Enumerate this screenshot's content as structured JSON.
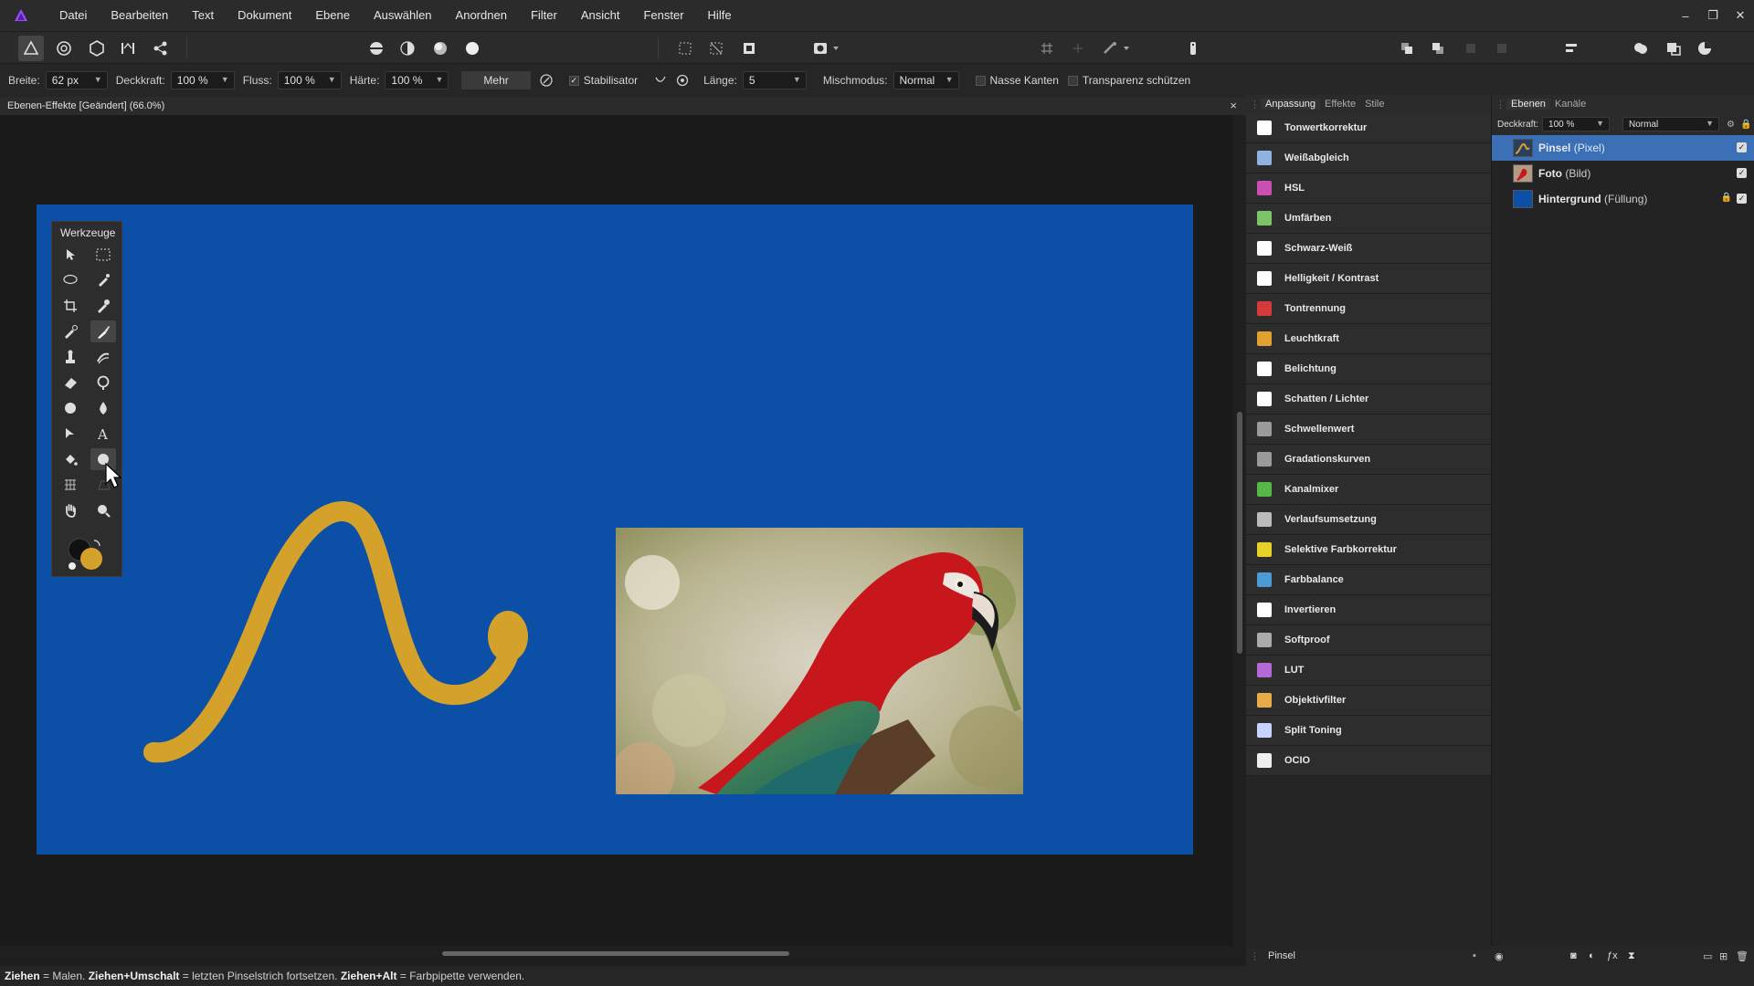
{
  "menu": [
    "Datei",
    "Bearbeiten",
    "Text",
    "Dokument",
    "Ebene",
    "Auswählen",
    "Anordnen",
    "Filter",
    "Ansicht",
    "Fenster",
    "Hilfe"
  ],
  "window_controls": {
    "minimize": "–",
    "restore": "❐",
    "close": "✕"
  },
  "context": {
    "width_label": "Breite:",
    "width_value": "62 px",
    "opacity_label": "Deckkraft:",
    "opacity_value": "100 %",
    "flow_label": "Fluss:",
    "flow_value": "100 %",
    "hardness_label": "Härte:",
    "hardness_value": "100 %",
    "more_label": "Mehr",
    "stabilizer_label": "Stabilisator",
    "length_label": "Länge:",
    "length_value": "5",
    "blend_label": "Mischmodus:",
    "blend_value": "Normal",
    "wet_edges_label": "Nasse Kanten",
    "protect_alpha_label": "Transparenz schützen"
  },
  "document": {
    "tab_title": "Ebenen-Effekte [Geändert] (66.0%)",
    "close": "×"
  },
  "tools": {
    "title": "Werkzeuge"
  },
  "adjustments": {
    "tabs": [
      "Anpassung",
      "Effekte",
      "Stile"
    ],
    "items": [
      {
        "label": "Tonwertkorrektur",
        "color": "#ffffff"
      },
      {
        "label": "Weißabgleich",
        "color": "#8fb4e0"
      },
      {
        "label": "HSL",
        "color": "#c94fb0"
      },
      {
        "label": "Umfärben",
        "color": "#7bc46a"
      },
      {
        "label": "Schwarz-Weiß",
        "color": "#ffffff"
      },
      {
        "label": "Helligkeit / Kontrast",
        "color": "#ffffff"
      },
      {
        "label": "Tontrennung",
        "color": "#d43a3a"
      },
      {
        "label": "Leuchtkraft",
        "color": "#e0a030"
      },
      {
        "label": "Belichtung",
        "color": "#ffffff"
      },
      {
        "label": "Schatten / Lichter",
        "color": "#ffffff"
      },
      {
        "label": "Schwellenwert",
        "color": "#9a9a9a"
      },
      {
        "label": "Gradationskurven",
        "color": "#9a9a9a"
      },
      {
        "label": "Kanalmixer",
        "color": "#56b847"
      },
      {
        "label": "Verlaufsumsetzung",
        "color": "#bbbbbb"
      },
      {
        "label": "Selektive Farbkorrektur",
        "color": "#e8d22a"
      },
      {
        "label": "Farbbalance",
        "color": "#4a9ad4"
      },
      {
        "label": "Invertieren",
        "color": "#ffffff"
      },
      {
        "label": "Softproof",
        "color": "#aaaaaa"
      },
      {
        "label": "LUT",
        "color": "#b36ad6"
      },
      {
        "label": "Objektivfilter",
        "color": "#e8a94a"
      },
      {
        "label": "Split Toning",
        "color": "#c8d4ff"
      },
      {
        "label": "OCIO",
        "color": "#eeeeee"
      }
    ]
  },
  "layers": {
    "tabs": [
      "Ebenen",
      "Kanäle"
    ],
    "opacity_label": "Deckkraft:",
    "opacity_value": "100 %",
    "blend_value": "Normal",
    "rows": [
      {
        "name": "Pinsel",
        "type": "(Pixel)"
      },
      {
        "name": "Foto",
        "type": "(Bild)"
      },
      {
        "name": "Hintergrund",
        "type": "(Füllung)"
      }
    ]
  },
  "bottom_bar": {
    "layer_name": "Pinsel"
  },
  "status": {
    "k1": "Ziehen",
    "t1": " = Malen. ",
    "k2": "Ziehen+Umschalt",
    "t2": " = letzten Pinselstrich fortsetzen. ",
    "k3": "Ziehen+Alt",
    "t3": " = Farbpipette verwenden."
  },
  "colors": {
    "canvas_bg": "#0c4fa6",
    "brush_stroke": "#d4a12a",
    "selection": "#3b6fb6",
    "accent": "#9b4dff"
  }
}
